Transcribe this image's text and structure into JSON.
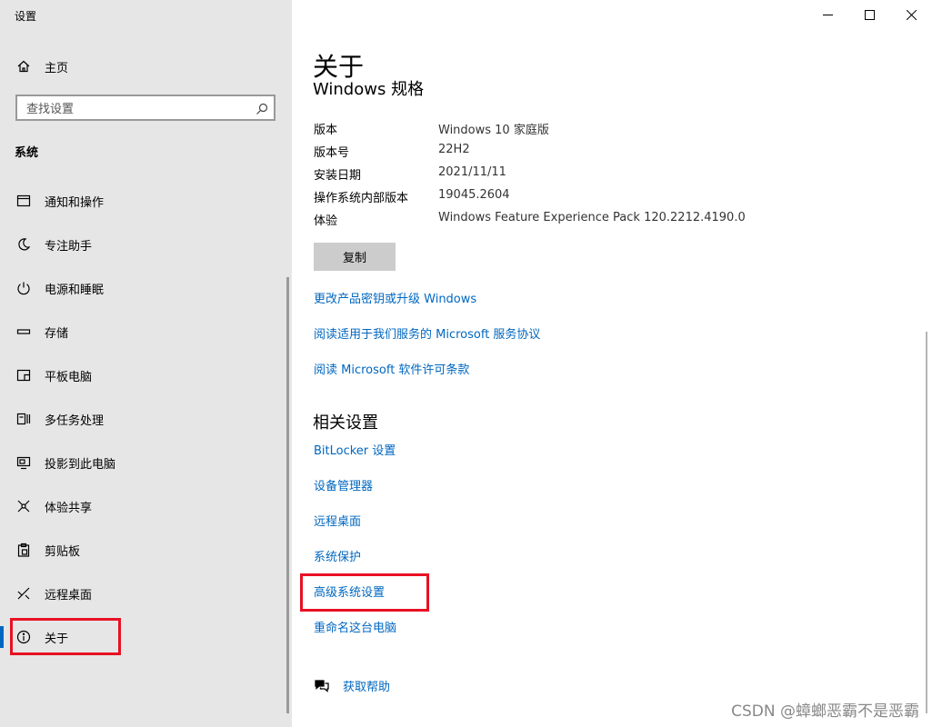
{
  "window": {
    "app_title": "设置"
  },
  "sidebar": {
    "home_label": "主页",
    "search_placeholder": "查找设置",
    "section_label": "系统",
    "items": [
      {
        "label": "通知和操作",
        "icon": "notification-icon"
      },
      {
        "label": "专注助手",
        "icon": "moon-icon"
      },
      {
        "label": "电源和睡眠",
        "icon": "power-icon"
      },
      {
        "label": "存储",
        "icon": "storage-icon"
      },
      {
        "label": "平板电脑",
        "icon": "tablet-icon"
      },
      {
        "label": "多任务处理",
        "icon": "multitask-icon"
      },
      {
        "label": "投影到此电脑",
        "icon": "project-icon"
      },
      {
        "label": "体验共享",
        "icon": "share-icon"
      },
      {
        "label": "剪贴板",
        "icon": "clipboard-icon"
      },
      {
        "label": "远程桌面",
        "icon": "remote-desktop-icon"
      },
      {
        "label": "关于",
        "icon": "info-icon",
        "selected": true
      }
    ]
  },
  "main": {
    "title": "关于",
    "subtitle": "Windows 规格",
    "specs": [
      {
        "label": "版本",
        "value": "Windows 10 家庭版"
      },
      {
        "label": "版本号",
        "value": "22H2"
      },
      {
        "label": "安装日期",
        "value": "2021/11/11"
      },
      {
        "label": "操作系统内部版本",
        "value": "19045.2604"
      },
      {
        "label": "体验",
        "value": "Windows Feature Experience Pack 120.2212.4190.0"
      }
    ],
    "copy_button": "复制",
    "links": [
      "更改产品密钥或升级 Windows",
      "阅读适用于我们服务的 Microsoft 服务协议",
      "阅读 Microsoft 软件许可条款"
    ],
    "related_title": "相关设置",
    "related_links": [
      "BitLocker 设置",
      "设备管理器",
      "远程桌面",
      "系统保护",
      "高级系统设置",
      "重命名这台电脑"
    ],
    "help_label": "获取帮助"
  },
  "watermark": "CSDN @蟑螂恶霸不是恶霸",
  "colors": {
    "accent": "#0067c0",
    "highlight_box": "#e81123",
    "sidebar_bg": "#e6e6e6"
  }
}
